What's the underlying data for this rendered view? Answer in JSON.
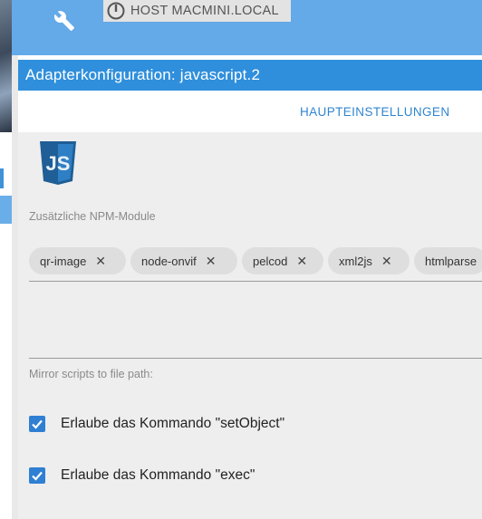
{
  "app": {
    "host_label": "HOST MACMINI.LOCAL"
  },
  "dialog": {
    "title": "Adapterkonfiguration: javascript.2",
    "tabs": [
      {
        "label": "HAUPTEINSTELLUNGEN",
        "active": true
      }
    ]
  },
  "settings": {
    "npm_modules_label": "Zusätzliche NPM-Module",
    "npm_modules": [
      {
        "label": "qr-image",
        "remove": "✕"
      },
      {
        "label": "node-onvif",
        "remove": "✕"
      },
      {
        "label": "pelcod",
        "remove": "✕"
      },
      {
        "label": "xml2js",
        "remove": "✕"
      },
      {
        "label": "htmlparse",
        "remove": ""
      }
    ],
    "mirror_label": "Mirror scripts to file path:",
    "mirror_value": "",
    "checkboxes": [
      {
        "label": "Erlaube das Kommando \"setObject\"",
        "checked": true
      },
      {
        "label": "Erlaube das Kommando \"exec\"",
        "checked": true
      }
    ]
  },
  "icons": {
    "wrench": "wrench-icon",
    "power": "power-icon",
    "logo": "javascript-logo-icon",
    "chip_remove": "close-icon",
    "checkbox": "checkmark-icon"
  },
  "colors": {
    "topbar": "#64a9e8",
    "title_bar": "#2f8fdc",
    "tab_text": "#2f86d0",
    "checkbox": "#2f7fd3",
    "content_bg": "#eeeeee"
  }
}
